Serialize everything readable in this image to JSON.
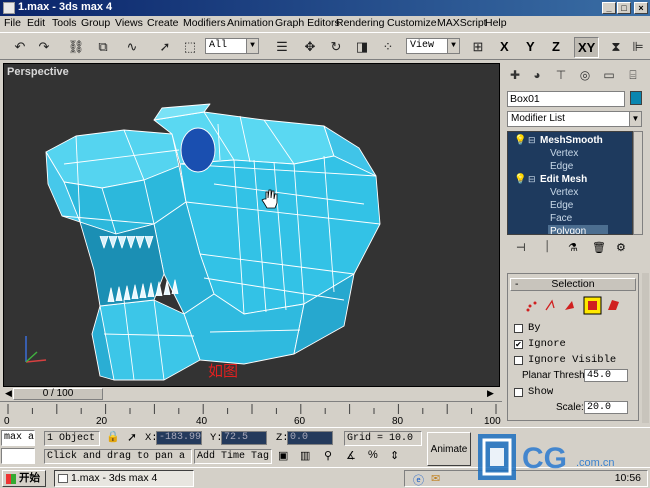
{
  "window": {
    "title": "1.max - 3ds max 4",
    "minimize": "_",
    "maximize": "□",
    "close": "×"
  },
  "menu": [
    "File",
    "Edit",
    "Tools",
    "Group",
    "Views",
    "Create",
    "Modifiers",
    "Animation",
    "Graph Editors",
    "Rendering",
    "Customize",
    "MAXScript",
    "Help"
  ],
  "toolbar": {
    "selection_filter": "All",
    "ref_coord": "View",
    "axis_x": "X",
    "axis_y": "Y",
    "axis_z": "Z",
    "axis_xy": "XY",
    "icons": [
      "undo-icon",
      "redo-icon",
      "link-icon",
      "unlink-icon",
      "bind-spacewarp-icon",
      "select-icon",
      "select-region-icon",
      "select-by-name-icon",
      "move-icon",
      "rotate-icon",
      "scale-icon",
      "mirror-icon"
    ]
  },
  "viewport": {
    "label": "Perspective",
    "annotation": "如图",
    "mesh_color": "#35c6e8",
    "eye_color": "#1a4fb0"
  },
  "timeline": {
    "frame_readout": "0 / 100",
    "ticks": [
      "0",
      "20",
      "40",
      "60",
      "80",
      "100"
    ]
  },
  "command_panel": {
    "tabs": [
      "create-tab-icon",
      "modify-tab-icon",
      "hierarchy-tab-icon",
      "motion-tab-icon",
      "display-tab-icon",
      "utilities-tab-icon"
    ],
    "object_name": "Box01",
    "object_color": "#0a86b0",
    "modifier_list": "Modifier List",
    "stack": [
      {
        "label": "MeshSmooth",
        "type": "header"
      },
      {
        "label": "Vertex",
        "type": "sub"
      },
      {
        "label": "Edge",
        "type": "sub"
      },
      {
        "label": "Edit Mesh",
        "type": "header"
      },
      {
        "label": "Vertex",
        "type": "sub"
      },
      {
        "label": "Edge",
        "type": "sub"
      },
      {
        "label": "Face",
        "type": "sub"
      },
      {
        "label": "Polygon",
        "type": "selected"
      }
    ],
    "rollout": {
      "title": "Selection",
      "collapse": "-",
      "by_label": "By",
      "ignore_label": "Ignore",
      "ignore_visible_label": "Ignore Visible",
      "planar_thresh_label": "Planar Thresh:",
      "planar_thresh_value": "45.0",
      "show_label": "Show",
      "scale_label": "Scale:",
      "scale_value": "20.0"
    }
  },
  "status": {
    "maxscript_label": "max a",
    "selection": "1 Object :",
    "x_label": "X:",
    "x_value": "-183.99",
    "y_label": "Y:",
    "y_value": "72.5",
    "z_label": "Z:",
    "z_value": "0.0",
    "grid": "Grid = 10.0",
    "prompt": "Click and drag to pan a no",
    "add_time_tag": "Add Time Tag",
    "animate": "Animate"
  },
  "taskbar": {
    "start": "开始",
    "task_item": "1.max - 3ds max 4",
    "clock": "10:56"
  },
  "logo": {
    "text": "CG",
    "site": ".com.cn"
  }
}
